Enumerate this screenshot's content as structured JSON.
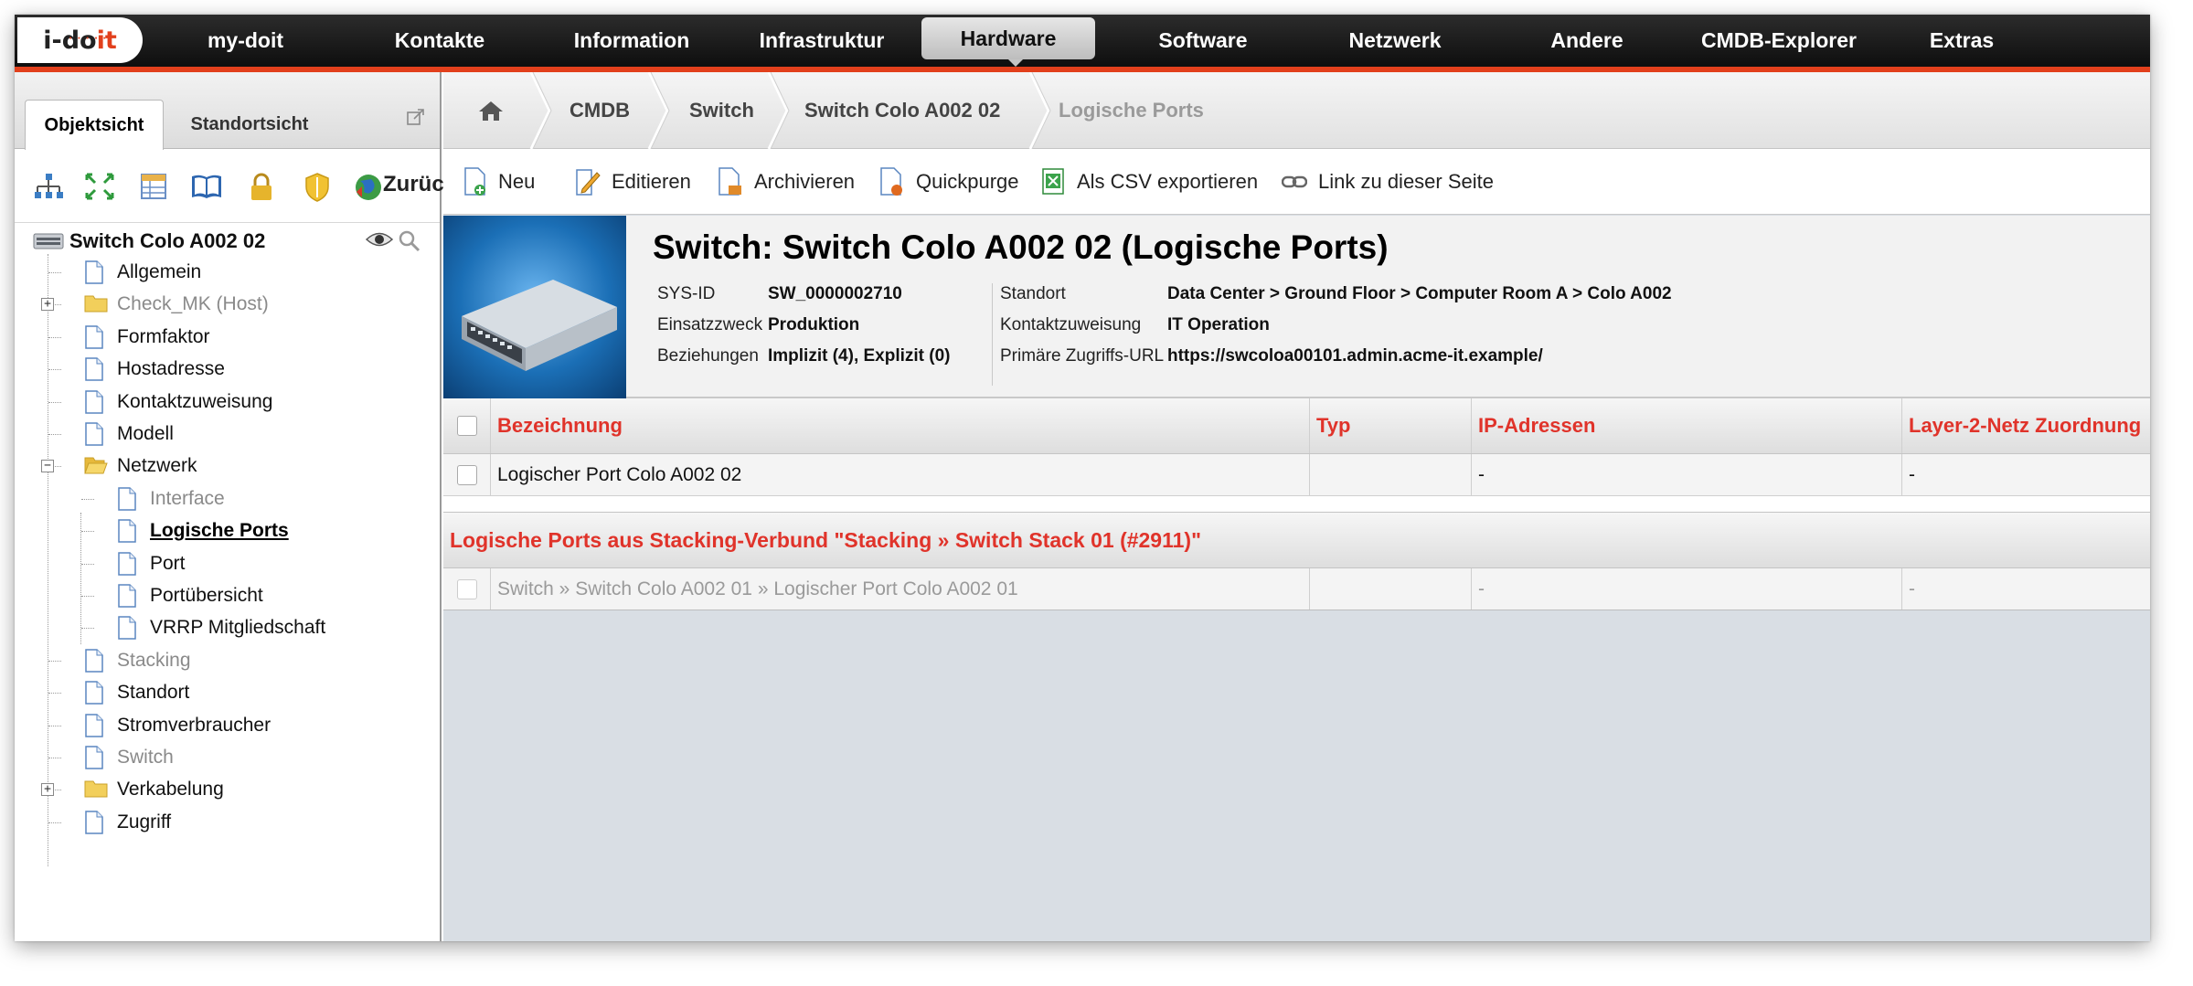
{
  "nav": {
    "logo": {
      "part1": "i-do",
      "part2": "it"
    },
    "items": [
      "my-doit",
      "Kontakte",
      "Information",
      "Infrastruktur",
      "Hardware",
      "Software",
      "Netzwerk",
      "Andere",
      "CMDB-Explorer",
      "Extras"
    ],
    "active": "Hardware"
  },
  "left_panel": {
    "tabs": [
      "Objektsicht",
      "Standortsicht"
    ],
    "active_tab": "Objektsicht",
    "toolbar_back_label": "Zurüc",
    "tree": {
      "root": "Switch Colo A002 02",
      "items": [
        {
          "label": "Allgemein",
          "type": "page",
          "state": "normal"
        },
        {
          "label": "Check_MK (Host)",
          "type": "folder",
          "state": "grey",
          "expander": "+"
        },
        {
          "label": "Formfaktor",
          "type": "page",
          "state": "normal"
        },
        {
          "label": "Hostadresse",
          "type": "page",
          "state": "normal"
        },
        {
          "label": "Kontaktzuweisung",
          "type": "page",
          "state": "normal"
        },
        {
          "label": "Modell",
          "type": "page",
          "state": "normal"
        },
        {
          "label": "Netzwerk",
          "type": "folder-open",
          "state": "normal",
          "expander": "−"
        },
        {
          "label": "Interface",
          "type": "page",
          "state": "grey",
          "child": true
        },
        {
          "label": "Logische Ports",
          "type": "page",
          "state": "selected",
          "child": true
        },
        {
          "label": "Port",
          "type": "page",
          "state": "normal",
          "child": true
        },
        {
          "label": "Portübersicht",
          "type": "page",
          "state": "normal",
          "child": true
        },
        {
          "label": "VRRP Mitgliedschaft",
          "type": "page",
          "state": "normal",
          "child": true
        },
        {
          "label": "Stacking",
          "type": "page",
          "state": "grey"
        },
        {
          "label": "Standort",
          "type": "page",
          "state": "normal"
        },
        {
          "label": "Stromverbraucher",
          "type": "page",
          "state": "normal"
        },
        {
          "label": "Switch",
          "type": "page",
          "state": "grey"
        },
        {
          "label": "Verkabelung",
          "type": "folder",
          "state": "normal",
          "expander": "+"
        },
        {
          "label": "Zugriff",
          "type": "page",
          "state": "normal"
        }
      ]
    }
  },
  "breadcrumb": [
    "CMDB",
    "Switch",
    "Switch Colo A002 02",
    "Logische Ports"
  ],
  "actions": [
    "Neu",
    "Editieren",
    "Archivieren",
    "Quickpurge",
    "Als CSV exportieren",
    "Link zu dieser Seite"
  ],
  "object": {
    "title": "Switch: Switch Colo A002 02 (Logische Ports)",
    "fields_left": [
      {
        "key": "SYS-ID",
        "value": "SW_0000002710"
      },
      {
        "key": "Einsatzzweck",
        "value": "Produktion"
      },
      {
        "key": "Beziehungen",
        "value": "Implizit (4), Explizit (0)"
      }
    ],
    "fields_right": [
      {
        "key": "Standort",
        "value": "Data Center > Ground Floor > Computer Room A > Colo A002"
      },
      {
        "key": "Kontaktzuweisung",
        "value": "IT Operation"
      },
      {
        "key": "Primäre Zugriffs-URL",
        "value": "https://swcoloa00101.admin.acme-it.example/"
      }
    ]
  },
  "table": {
    "headers": [
      "Bezeichnung",
      "Typ",
      "IP-Adressen",
      "Layer-2-Netz Zuordnung"
    ],
    "rows": [
      [
        "Logischer Port Colo A002 02",
        "",
        "-",
        "-"
      ]
    ],
    "stack_section_title": "Logische Ports aus Stacking-Verbund \"Stacking » Switch Stack 01 (#2911)\"",
    "stack_rows": [
      [
        "Switch » Switch Colo A002 01 » Logischer Port Colo A002 01",
        "",
        "-",
        "-"
      ]
    ]
  },
  "colors": {
    "accent": "#e2401c",
    "header_text": "#e0332a",
    "nav_bg": "#1a1a1a"
  }
}
